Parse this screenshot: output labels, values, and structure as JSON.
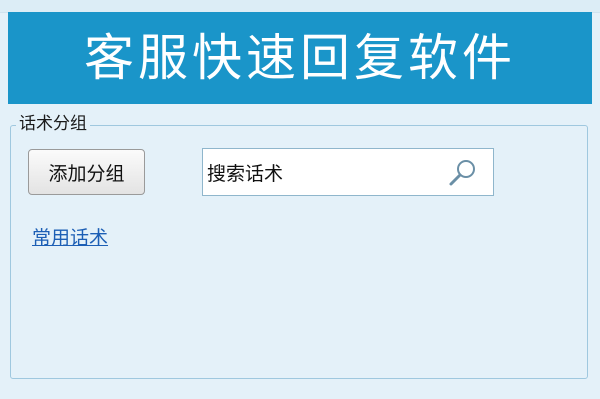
{
  "banner": {
    "title": "客服快速回复软件"
  },
  "group": {
    "legend": "话术分组",
    "add_button_label": "添加分组",
    "search": {
      "value": "搜索话术",
      "icon": "search-icon"
    },
    "links": [
      "常用话术"
    ]
  },
  "colors": {
    "banner": "#1a95c9",
    "background": "#e4f1f9",
    "link": "#1d5fb5"
  }
}
